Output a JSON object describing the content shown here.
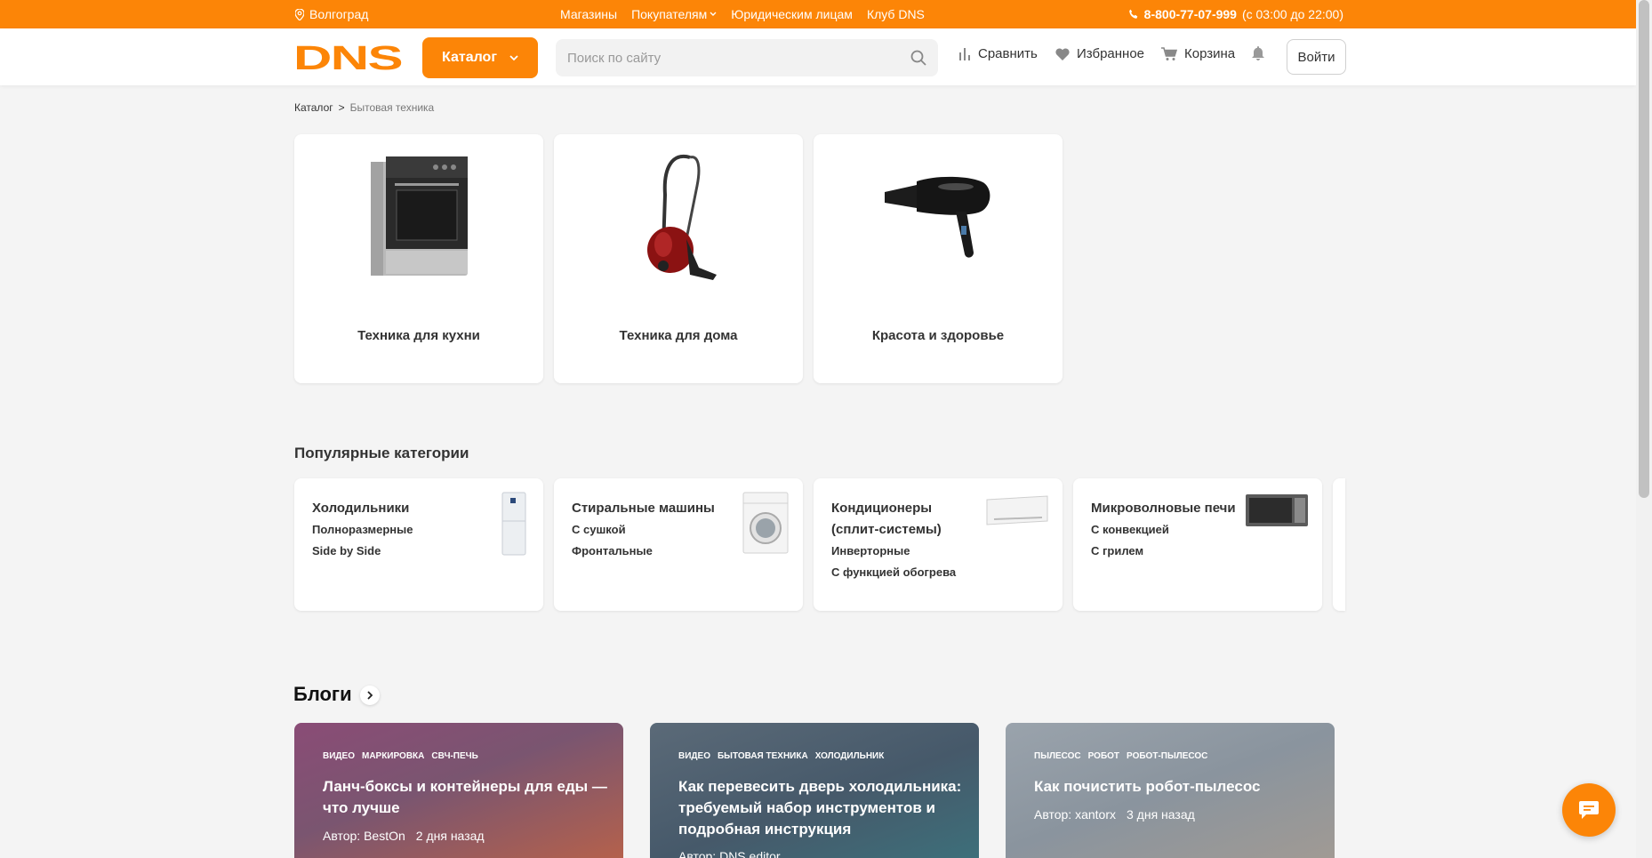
{
  "topbar": {
    "city": "Волгоград",
    "links": [
      "Магазины",
      "Покупателям",
      "Юридическим лицам",
      "Клуб DNS"
    ],
    "phone": "8-800-77-07-999",
    "hours": "(с 03:00 до 22:00)"
  },
  "header": {
    "logo": "DNS",
    "catalog_label": "Каталог",
    "search_placeholder": "Поиск по сайту",
    "compare_label": "Сравнить",
    "favorites_label": "Избранное",
    "cart_label": "Корзина",
    "login_label": "Войти"
  },
  "breadcrumb": {
    "root": "Каталог",
    "separator": ">",
    "current": "Бытовая техника"
  },
  "categories": [
    {
      "label": "Техника для кухни"
    },
    {
      "label": "Техника для дома"
    },
    {
      "label": "Красота и здоровье"
    }
  ],
  "popular": {
    "title": "Популярные категории",
    "items": [
      {
        "title": "Холодильники",
        "subs": [
          "Полноразмерные",
          "Side by Side"
        ]
      },
      {
        "title": "Стиральные машины",
        "subs": [
          "С сушкой",
          "Фронтальные"
        ]
      },
      {
        "title": "Кондиционеры (сплит-системы)",
        "subs": [
          "Инвертoрные",
          "С функцией обогрева"
        ]
      },
      {
        "title": "Микроволновые печи",
        "subs": [
          "С конвекцией",
          "С грилем"
        ]
      }
    ]
  },
  "blogs": {
    "title": "Блоги",
    "items": [
      {
        "tags": [
          "видео",
          "маркировка",
          "свч-печь"
        ],
        "title": "Ланч-боксы и контейнеры для еды — что лучше",
        "author_label": "Автор:",
        "author": "BestOn",
        "time": "2 дня назад",
        "color": "#8a4a6a"
      },
      {
        "tags": [
          "видео",
          "бытовая техника",
          "холодильник"
        ],
        "title": "Как перевесить дверь холодильника: требуемый набор инструментов и подробная инструкция",
        "author_label": "Автор:",
        "author": "DNS editor",
        "time": "",
        "color": "#4d5f6e"
      },
      {
        "tags": [
          "пылесос",
          "робот",
          "робот-пылесос"
        ],
        "title": "Как почистить робот-пылесос",
        "author_label": "Автор:",
        "author": "xantorx",
        "time": "3 дня назад",
        "color": "#8d97a1"
      }
    ]
  },
  "colors": {
    "brand": "#fc8507",
    "background": "#f4f4f4"
  }
}
